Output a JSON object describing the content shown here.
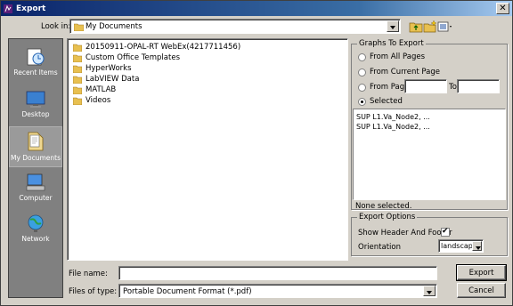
{
  "window": {
    "title": "Export",
    "close_glyph": "✕"
  },
  "lookin": {
    "label": "Look in:",
    "value": "My Documents"
  },
  "toolbar": {
    "icons": [
      "up-folder-icon",
      "new-folder-icon",
      "view-menu-icon"
    ]
  },
  "places": [
    {
      "id": "recent",
      "label": "Recent Items",
      "icon": "recent-items-icon"
    },
    {
      "id": "desktop",
      "label": "Desktop",
      "icon": "desktop-icon"
    },
    {
      "id": "mydocs",
      "label": "My Documents",
      "icon": "my-documents-icon",
      "selected": true
    },
    {
      "id": "computer",
      "label": "Computer",
      "icon": "computer-icon"
    },
    {
      "id": "network",
      "label": "Network",
      "icon": "network-icon"
    }
  ],
  "files": [
    "20150911-OPAL-RT WebEx(4217711456)",
    "Custom Office Templates",
    "HyperWorks",
    "LabVIEW Data",
    "MATLAB",
    "Videos"
  ],
  "graphs_to_export": {
    "title": "Graphs To Export",
    "options": {
      "all": "From All Pages",
      "current": "From Current Page",
      "page": "From Page",
      "to": "To",
      "selected": "Selected"
    },
    "selected_option": "selected",
    "page_from": "",
    "page_to": "",
    "items": [
      "SUP L1.Va_Node2, ...",
      "SUP L1.Va_Node2, ..."
    ],
    "status": "None selected."
  },
  "export_options": {
    "title": "Export Options",
    "header_footer_label": "Show Header And Footer",
    "header_footer_checked": true,
    "orientation_label": "Orientation",
    "orientation_value": "landscape"
  },
  "footer": {
    "filename_label": "File name:",
    "filename_value": "",
    "filetype_label": "Files of type:",
    "filetype_value": "Portable Document Format (*.pdf)",
    "export_button": "Export",
    "cancel_button": "Cancel"
  },
  "colors": {
    "title_bar": "#0a246a",
    "dialog_bg": "#d4d0c8",
    "places_bg": "#808080"
  }
}
